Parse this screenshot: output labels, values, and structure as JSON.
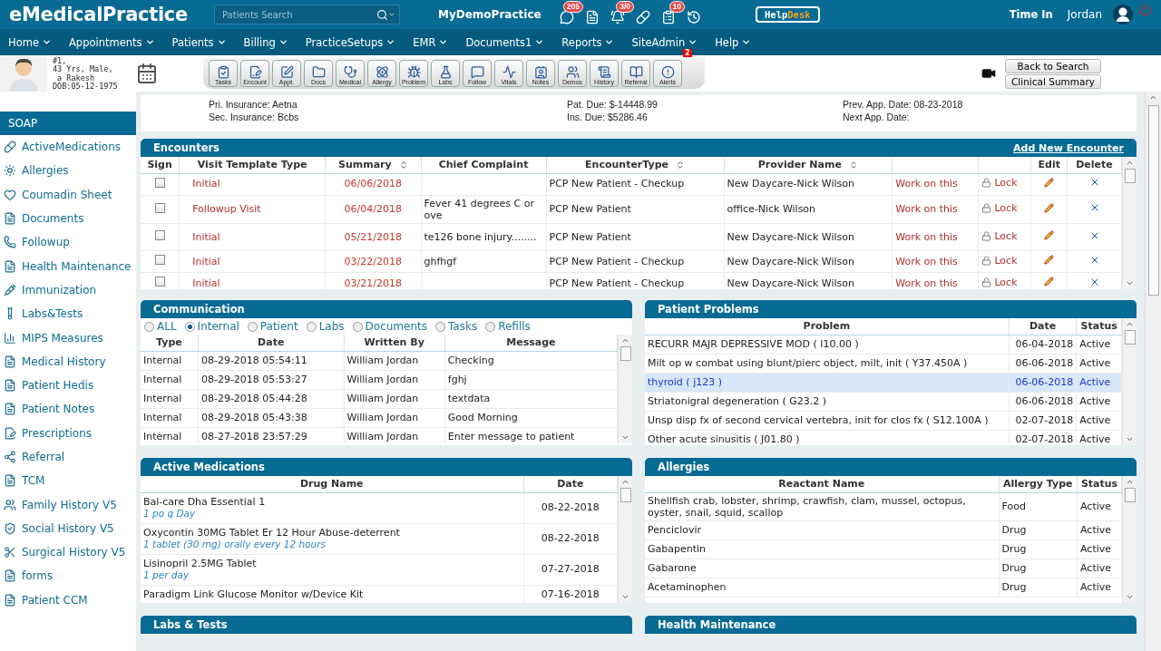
{
  "header": {
    "logo": "eMedicalPractice",
    "search": {
      "placeholder": "Patients Search"
    },
    "practice": "MyDemoPractice",
    "icons": [
      {
        "kind": "messages",
        "badge": "205"
      },
      {
        "kind": "documents"
      },
      {
        "kind": "alerts",
        "badge": "3/0"
      },
      {
        "kind": "rx"
      },
      {
        "kind": "tasks",
        "badge": "10"
      },
      {
        "kind": "history"
      }
    ],
    "helpdesk": [
      "Help",
      "Desk"
    ],
    "time_in": "Time In",
    "user": "Jordan"
  },
  "nav": [
    "Home",
    "Appointments",
    "Patients",
    "Billing",
    "PracticeSetups",
    "EMR",
    "Documents1",
    "Reports",
    "SiteAdmin",
    "Help"
  ],
  "patient": {
    "lines": [
      "#1,",
      "43 Yrs, Male,",
      " a Rakesh",
      "DOB:05-12-1975"
    ]
  },
  "toolbar": [
    {
      "label": "Tasks"
    },
    {
      "label": "Encount"
    },
    {
      "label": "Appt."
    },
    {
      "label": "Docs"
    },
    {
      "label": "Medical"
    },
    {
      "label": "Allergy"
    },
    {
      "label": "Problem"
    },
    {
      "label": "Labs"
    },
    {
      "label": "Follow"
    },
    {
      "label": "Vitals"
    },
    {
      "label": "Notes"
    },
    {
      "label": "Demos"
    },
    {
      "label": "History"
    },
    {
      "label": "Referral"
    },
    {
      "label": "Alerts",
      "badge": "2"
    }
  ],
  "actions": [
    "Back to Search",
    "Clinical Summary"
  ],
  "sidebar": {
    "title": "SOAP",
    "items": [
      "ActiveMedications",
      "Allergies",
      "Coumadin Sheet",
      "Documents",
      "Followup",
      "Health Maintenance",
      "Immunization",
      "Labs&Tests",
      "MIPS Measures",
      "Medical History",
      "Patient Hedis",
      "Patient Notes",
      "Prescriptions",
      "Referral",
      "TCM",
      "Family History V5",
      "Social History V5",
      "Surgical History V5",
      "forms",
      "Patient CCM"
    ]
  },
  "insurance": [
    [
      {
        "label": "Pri. Insurance:",
        "value": "Aetna"
      },
      {
        "label": "Sec. Insurance:",
        "value": "Bcbs"
      }
    ],
    [
      {
        "label": "Pat. Due:",
        "value": "$-14448.99"
      },
      {
        "label": "Ins. Due:",
        "value": "$5286.46"
      }
    ],
    [
      {
        "label": "Prev. App. Date:",
        "value": "08-23-2018"
      },
      {
        "label": "Next App. Date:"
      }
    ]
  ],
  "encounters": {
    "title": "Encounters",
    "link": "Add New Encounter",
    "columns": [
      {
        "label": "Sign",
        "sortable": false
      },
      {
        "label": "Visit Template Type",
        "sortable": false
      },
      {
        "label": "Summary",
        "sortable": true
      },
      {
        "label": "Chief Complaint",
        "sortable": false
      },
      {
        "label": "EncounterType",
        "sortable": true
      },
      {
        "label": "Provider Name",
        "sortable": true
      },
      {
        "label": "Edit",
        "sortable": false
      },
      {
        "label": "Delete",
        "sortable": false
      }
    ],
    "rows": [
      {
        "checked": false,
        "template": "Initial",
        "date": "06/06/2018",
        "type": "PCP New Patient - Checkup",
        "provider": "New Daycare-Nick Wilson",
        "work": "Work on this",
        "lock": "Lock"
      },
      {
        "checked": false,
        "template": "Followup Visit",
        "date": "06/04/2018",
        "complaint": "Fever 41 degrees C or ove",
        "type": "PCP New Patient",
        "provider": "office-Nick Wilson",
        "work": "Work on this",
        "lock": "Lock"
      },
      {
        "checked": false,
        "template": "Initial",
        "date": "05/21/2018",
        "complaint": "te126 bone injury........",
        "type": "PCP New Patient",
        "provider": "New Daycare-Nick Wilson",
        "work": "Work on this",
        "lock": "Lock"
      },
      {
        "checked": false,
        "template": "Initial",
        "date": "03/22/2018",
        "complaint": "ghfhgf",
        "type": "PCP New Patient - Checkup",
        "provider": "New Daycare-Nick Wilson",
        "work": "Work on this",
        "lock": "Lock"
      },
      {
        "checked": false,
        "template": "Initial",
        "date": "03/21/2018",
        "type": "PCP New Patient - Checkup",
        "provider": "New Daycare-Nick Wilson",
        "work": "Work on this",
        "lock": "Lock"
      }
    ]
  },
  "communication": {
    "title": "Communication",
    "filters": [
      {
        "label": "ALL",
        "selected": false
      },
      {
        "label": "Internal",
        "selected": true
      },
      {
        "label": "Patient",
        "selected": false
      },
      {
        "label": "Labs",
        "selected": false
      },
      {
        "label": "Documents",
        "selected": false
      },
      {
        "label": "Tasks",
        "selected": false
      },
      {
        "label": "Refills",
        "selected": false
      }
    ],
    "columns": [
      "Type",
      "Date",
      "Written By",
      "Message"
    ],
    "rows": [
      [
        "Internal",
        "08-29-2018 05:54:11",
        "William Jordan",
        "Checking"
      ],
      [
        "Internal",
        "08-29-2018 05:53:27",
        "William Jordan",
        "fghj"
      ],
      [
        "Internal",
        "08-29-2018 05:44:28",
        "William Jordan",
        "textdata"
      ],
      [
        "Internal",
        "08-29-2018 05:43:38",
        "William Jordan",
        "Good Morning"
      ],
      [
        "Internal",
        "08-27-2018 23:57:29",
        "William Jordan",
        "Enter message to patient"
      ]
    ]
  },
  "problems": {
    "title": "Patient Problems",
    "columns": [
      "Problem",
      "Date",
      "Status"
    ],
    "rows": [
      {
        "problem": "RECURR MAJR DEPRESSIVE MOD ( I10.00 )",
        "date": "06-04-2018",
        "status": "Active",
        "selected": false
      },
      {
        "problem": "Milt op w combat using blunt/pierc object, milt, init ( Y37.450A )",
        "date": "06-06-2018",
        "status": "Active",
        "selected": false
      },
      {
        "problem": "thyroid ( j123 )",
        "date": "06-06-2018",
        "status": "Active",
        "selected": true
      },
      {
        "problem": "Striatonigral degeneration ( G23.2 )",
        "date": "06-06-2018",
        "status": "Active",
        "selected": false
      },
      {
        "problem": "Unsp disp fx of second cervical vertebra, init for clos fx ( S12.100A )",
        "date": "02-07-2018",
        "status": "Active",
        "selected": false
      },
      {
        "problem": "Other acute sinusitis ( J01.80 )",
        "date": "02-07-2018",
        "status": "Active",
        "selected": false
      }
    ]
  },
  "medications": {
    "title": "Active Medications",
    "columns": [
      "Drug Name",
      "Date"
    ],
    "rows": [
      {
        "name": "Bal-care Dha Essential 1",
        "sig": "1 po q Day",
        "date": "08-22-2018"
      },
      {
        "name": "Oxycontin 30MG Tablet Er 12 Hour Abuse-deterrent",
        "sig": "1 tablet (30 mg) orally every 12 hours",
        "date": "08-22-2018"
      },
      {
        "name": "Lisinopril 2.5MG Tablet",
        "sig": "1 per day",
        "date": "07-27-2018"
      },
      {
        "name": "Paradigm Link Glucose Monitor w/Device Kit",
        "date": "07-16-2018"
      }
    ]
  },
  "allergies": {
    "title": "Allergies",
    "columns": [
      "Reactant Name",
      "Allergy Type",
      "Status"
    ],
    "rows": [
      [
        "Shellfish crab, lobster, shrimp, crawfish, clam, mussel, octopus, oyster, snail, squid, scallop",
        "Food",
        "Active"
      ],
      [
        "Penciclovir",
        "Drug",
        "Active"
      ],
      [
        "Gabapentin",
        "Drug",
        "Active"
      ],
      [
        "Gabarone",
        "Drug",
        "Active"
      ],
      [
        "Acetaminophen",
        "Drug",
        "Active"
      ]
    ]
  },
  "labs": {
    "title": "Labs & Tests"
  },
  "health": {
    "title": "Health Maintenance"
  }
}
